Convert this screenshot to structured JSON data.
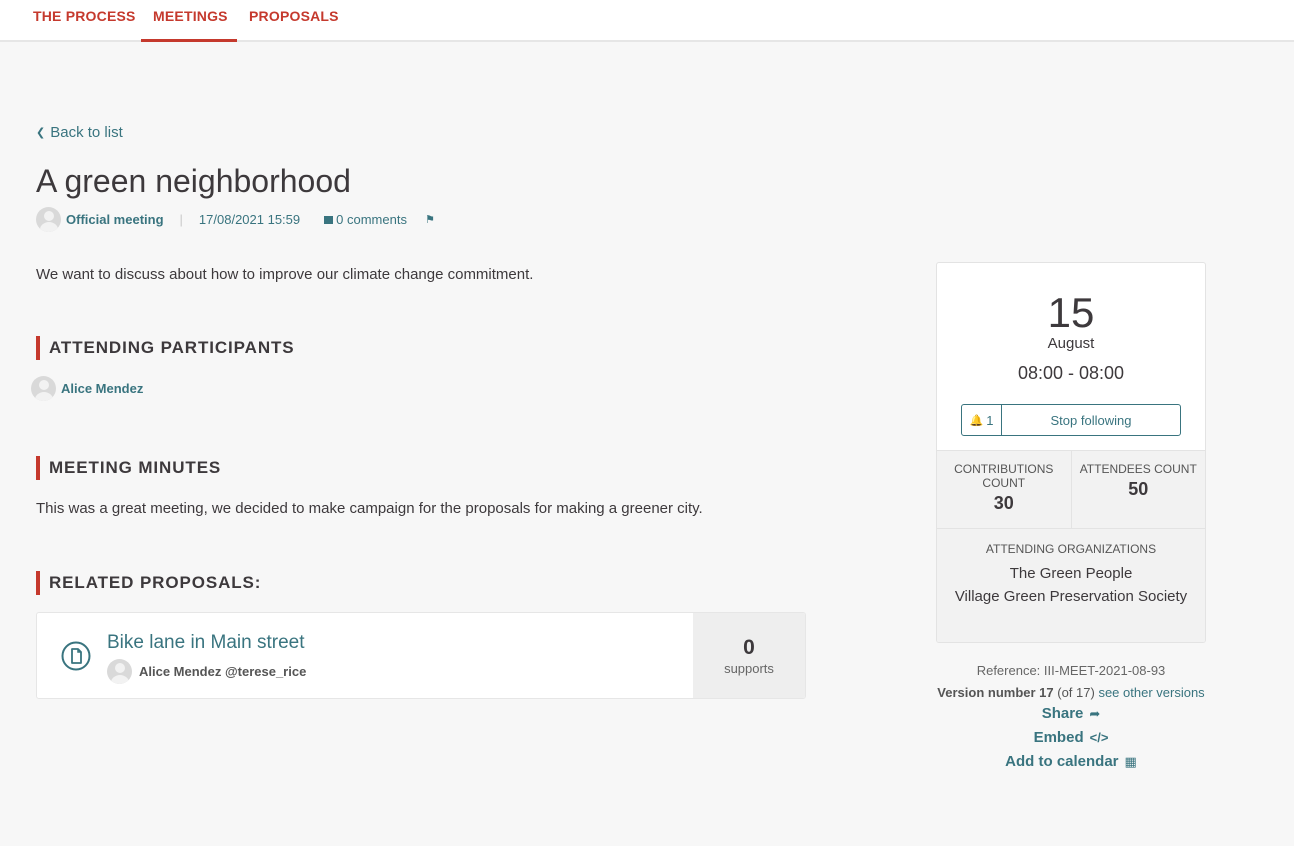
{
  "nav": {
    "tabs": [
      {
        "label": "THE PROCESS"
      },
      {
        "label": "MEETINGS"
      },
      {
        "label": "PROPOSALS"
      }
    ]
  },
  "back_link": "Back to list",
  "meeting": {
    "title": "A green neighborhood",
    "author": "Official meeting",
    "date": "17/08/2021 15:59",
    "comments": "0 comments",
    "description": "We want to discuss about how to improve our climate change commitment."
  },
  "sections": {
    "attending": "ATTENDING PARTICIPANTS",
    "minutes": "MEETING MINUTES",
    "related": "RELATED PROPOSALS:"
  },
  "participants": [
    {
      "name": "Alice Mendez"
    }
  ],
  "minutes_text": "This was a great meeting, we decided to make campaign for the proposals for making a greener city.",
  "proposal": {
    "title": "Bike lane in Main street",
    "author": "Alice Mendez @terese_rice",
    "supports_count": "0",
    "supports_label": "supports"
  },
  "date_card": {
    "day": "15",
    "month": "August",
    "time": "08:00 - 08:00",
    "follow_count": "1",
    "follow_label": "Stop following",
    "contributions_label": "CONTRIBUTIONS COUNT",
    "contributions_value": "30",
    "attendees_label": "ATTENDEES COUNT",
    "attendees_value": "50",
    "orgs_label": "ATTENDING ORGANIZATIONS",
    "orgs": [
      "The Green People",
      "Village Green Preservation Society"
    ]
  },
  "sidebar": {
    "reference": "Reference: III-MEET-2021-08-93",
    "version_label": "Version number 17",
    "version_of": "(of 17)",
    "other_versions": "see other versions",
    "share": "Share",
    "embed": "Embed",
    "calendar": "Add to calendar"
  },
  "colors": {
    "accent": "#c5392d",
    "link": "#39747f",
    "text": "#3d393c"
  },
  "icons": [
    "chevron-left-icon",
    "comment-icon",
    "flag-icon",
    "document-icon",
    "bell-icon",
    "share-icon",
    "embed-icon",
    "calendar-icon"
  ]
}
